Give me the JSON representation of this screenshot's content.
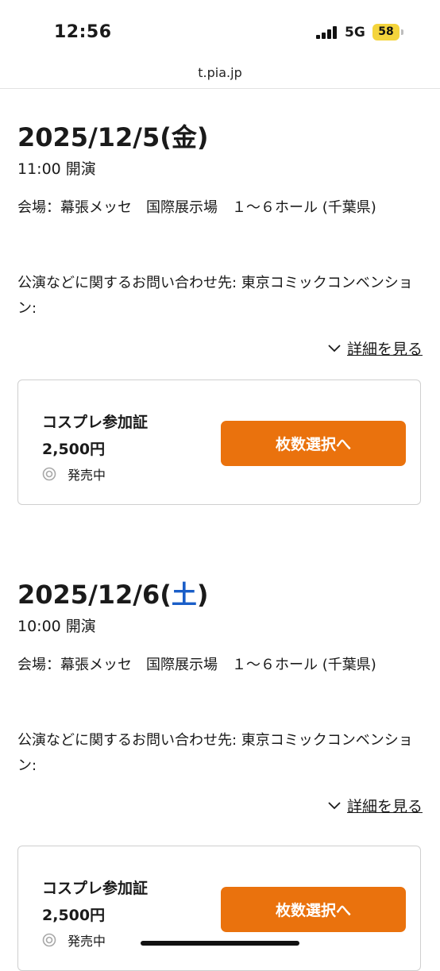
{
  "status_bar": {
    "time": "12:56",
    "network": "5G",
    "battery": "58"
  },
  "browser": {
    "url": "t.pia.jp"
  },
  "performances": [
    {
      "date": "2025/12/5(",
      "day_of_week": "金",
      "date_close": ")",
      "start_time": "11:00 開演",
      "venue": "会場：幕張メッセ　国際展示場　１～６ホール (千葉県)",
      "contact": "公演などに関するお問い合わせ先: 東京コミックコンベンション:",
      "details_label": "詳細を見る",
      "ticket": {
        "name": "コスプレ参加証",
        "price": "2,500円",
        "status": "発売中",
        "button_label": "枚数選択へ"
      }
    },
    {
      "date": "2025/12/6(",
      "day_of_week": "土",
      "date_close": ")",
      "start_time": "10:00 開演",
      "venue": "会場：幕張メッセ　国際展示場　１～６ホール (千葉県)",
      "contact": "公演などに関するお問い合わせ先: 東京コミックコンベンション:",
      "details_label": "詳細を見る",
      "ticket": {
        "name": "コスプレ参加証",
        "price": "2,500円",
        "status": "発売中",
        "button_label": "枚数選択へ"
      }
    }
  ],
  "colors": {
    "accent": "#ea720d",
    "saturday": "#1a5ec8",
    "border": "#cfcfcf"
  }
}
